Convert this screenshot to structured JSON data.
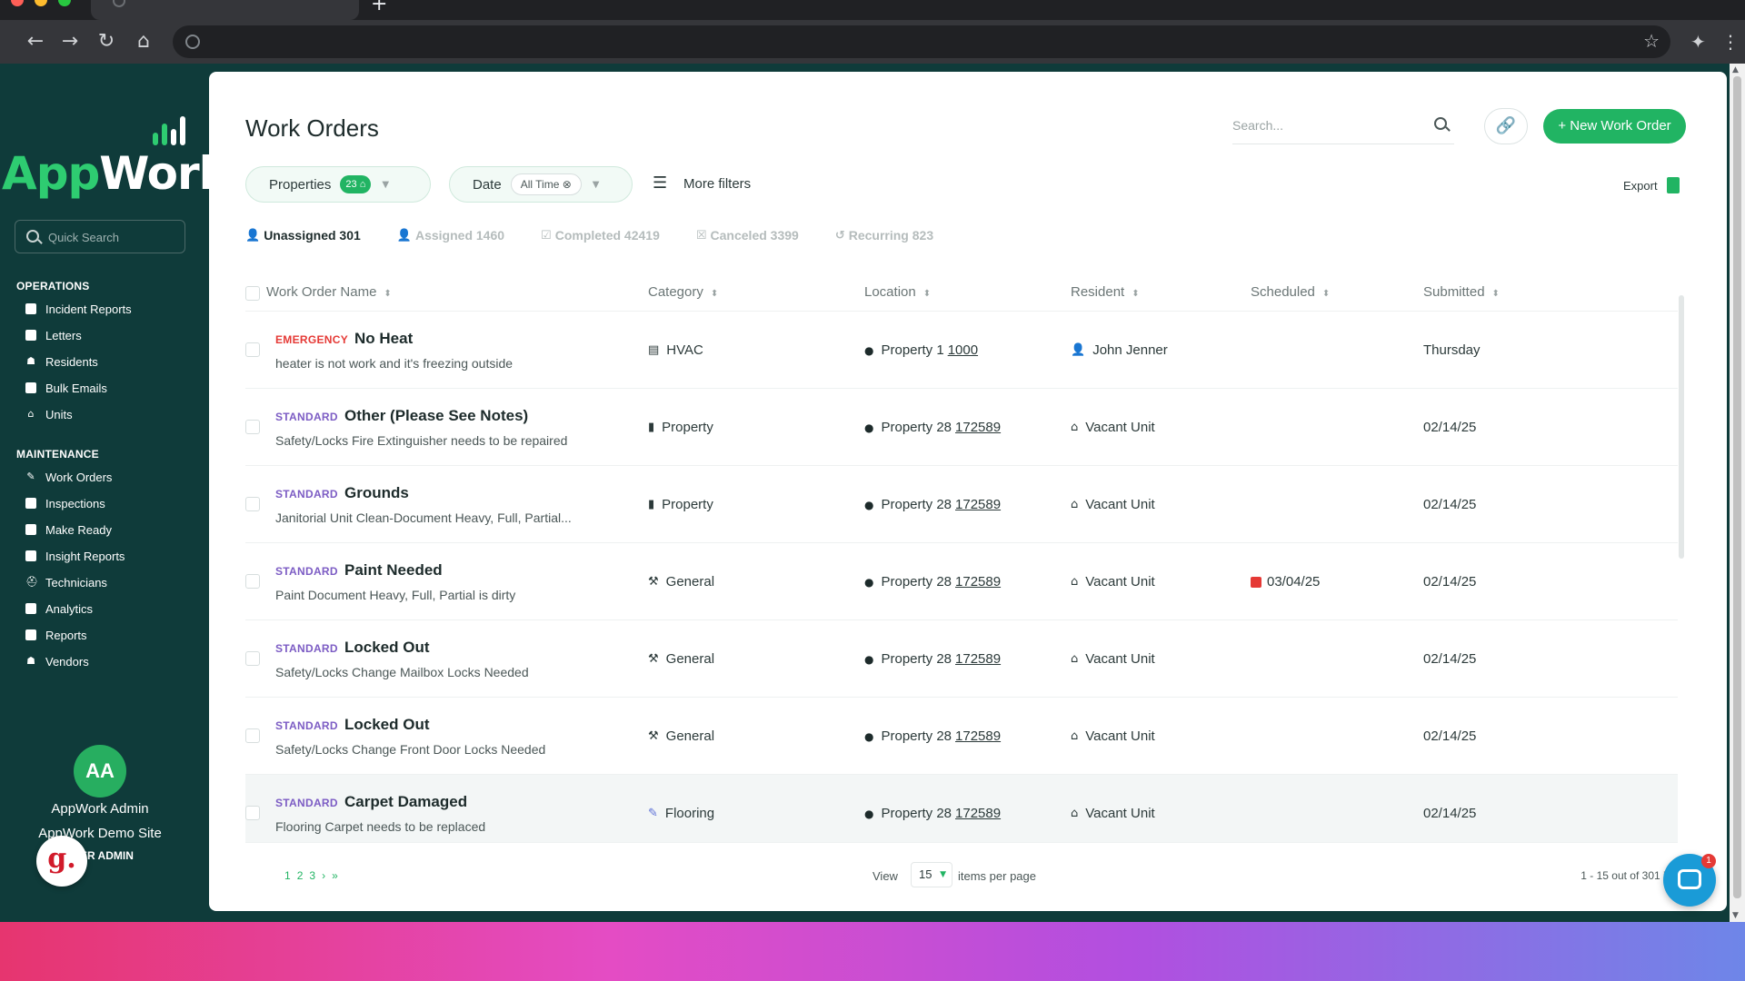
{
  "browser": {
    "new_tab_glyph": "+",
    "nav": {
      "back": "←",
      "forward": "→",
      "reload": "↻",
      "home": "⌂"
    },
    "bookmark_glyph": "☆",
    "extensions_glyph": "✦",
    "menu_glyph": "⋮"
  },
  "sidebar": {
    "logo_app": "App",
    "logo_work": "Work",
    "quick_search_placeholder": "Quick Search",
    "operations_title": "OPERATIONS",
    "operations": [
      {
        "label": "Incident Reports",
        "icon": "document-icon"
      },
      {
        "label": "Letters",
        "icon": "letter-icon"
      },
      {
        "label": "Residents",
        "icon": "residents-icon"
      },
      {
        "label": "Bulk Emails",
        "icon": "mail-icon"
      },
      {
        "label": "Units",
        "icon": "home-icon"
      }
    ],
    "maintenance_title": "MAINTENANCE",
    "maintenance": [
      {
        "label": "Work Orders",
        "icon": "wrench-icon"
      },
      {
        "label": "Inspections",
        "icon": "clipboard-icon"
      },
      {
        "label": "Make Ready",
        "icon": "paint-icon"
      },
      {
        "label": "Insight Reports",
        "icon": "report-icon"
      },
      {
        "label": "Technicians",
        "icon": "technician-icon"
      },
      {
        "label": "Analytics",
        "icon": "chart-icon"
      },
      {
        "label": "Reports",
        "icon": "report-icon"
      },
      {
        "label": "Vendors",
        "icon": "vendor-icon"
      }
    ],
    "user": {
      "initials": "AA",
      "name": "AppWork Admin",
      "site": "AppWork Demo Site",
      "role": "ER ADMIN"
    },
    "g_badge": "g."
  },
  "header": {
    "title": "Work Orders",
    "search_placeholder": "Search...",
    "new_button": "+ New Work Order",
    "link_glyph": "🔗"
  },
  "filters": {
    "properties_label": "Properties",
    "properties_count": "23",
    "properties_badge_glyph": "⌂",
    "date_label": "Date",
    "date_value": "All Time",
    "date_clear_glyph": "⊗",
    "caret": "▼",
    "more_filters": "More filters",
    "more_filters_glyph": "☰",
    "export": "Export"
  },
  "status_tabs": [
    {
      "label": "Unassigned 301",
      "icon": "👤",
      "active": true
    },
    {
      "label": "Assigned 1460",
      "icon": "👤",
      "active": false
    },
    {
      "label": "Completed 42419",
      "icon": "☑",
      "active": false
    },
    {
      "label": "Canceled 3399",
      "icon": "☒",
      "active": false
    },
    {
      "label": "Recurring 823",
      "icon": "↺",
      "active": false
    }
  ],
  "table": {
    "columns": {
      "name": "Work Order Name",
      "category": "Category",
      "location": "Location",
      "resident": "Resident",
      "scheduled": "Scheduled",
      "submitted": "Submitted"
    },
    "sort_glyph": "⬍",
    "rows": [
      {
        "priority": "EMERGENCY",
        "title": "No Heat",
        "desc": "heater is not work and it's freezing outside",
        "category": "HVAC",
        "cat_icon": "▤",
        "location": "Property 1",
        "unit": "1000",
        "resident": "John Jenner",
        "res_icon": "👤",
        "scheduled": "",
        "submitted": "Thursday"
      },
      {
        "priority": "STANDARD",
        "title": "Other (Please See Notes)",
        "desc": "Safety/Locks Fire Extinguisher needs to be repaired",
        "category": "Property",
        "cat_icon": "▮",
        "location": "Property 28",
        "unit": "172589",
        "resident": "Vacant Unit",
        "res_icon": "⌂",
        "scheduled": "",
        "submitted": "02/14/25"
      },
      {
        "priority": "STANDARD",
        "title": "Grounds",
        "desc": "Janitorial Unit Clean-Document Heavy, Full, Partial...",
        "category": "Property",
        "cat_icon": "▮",
        "location": "Property 28",
        "unit": "172589",
        "resident": "Vacant Unit",
        "res_icon": "⌂",
        "scheduled": "",
        "submitted": "02/14/25"
      },
      {
        "priority": "STANDARD",
        "title": "Paint Needed",
        "desc": "Paint Document Heavy, Full, Partial is dirty",
        "category": "General",
        "cat_icon": "⚒",
        "location": "Property 28",
        "unit": "172589",
        "resident": "Vacant Unit",
        "res_icon": "⌂",
        "scheduled": "03/04/25",
        "submitted": "02/14/25"
      },
      {
        "priority": "STANDARD",
        "title": "Locked Out",
        "desc": "Safety/Locks Change Mailbox Locks Needed",
        "category": "General",
        "cat_icon": "⚒",
        "location": "Property 28",
        "unit": "172589",
        "resident": "Vacant Unit",
        "res_icon": "⌂",
        "scheduled": "",
        "submitted": "02/14/25"
      },
      {
        "priority": "STANDARD",
        "title": "Locked Out",
        "desc": "Safety/Locks Change Front Door Locks Needed",
        "category": "General",
        "cat_icon": "⚒",
        "location": "Property 28",
        "unit": "172589",
        "resident": "Vacant Unit",
        "res_icon": "⌂",
        "scheduled": "",
        "submitted": "02/14/25"
      },
      {
        "priority": "STANDARD",
        "title": "Carpet Damaged",
        "desc": "Flooring Carpet needs to be replaced",
        "category": "Flooring",
        "cat_icon": "✎",
        "location": "Property 28",
        "unit": "172589",
        "resident": "Vacant Unit",
        "res_icon": "⌂",
        "scheduled": "",
        "submitted": "02/14/25"
      }
    ],
    "pin_glyph": "●"
  },
  "pagination": {
    "pages": [
      "1",
      "2",
      "3",
      "›",
      "»"
    ],
    "view_label": "View",
    "per_page": "15",
    "per_page_caret": "▼",
    "items_per_page": "items per page",
    "range": "1 - 15 out of 301 it"
  },
  "chat": {
    "badge": "1"
  },
  "window_scroll": {
    "up": "▲",
    "down": "▼"
  }
}
